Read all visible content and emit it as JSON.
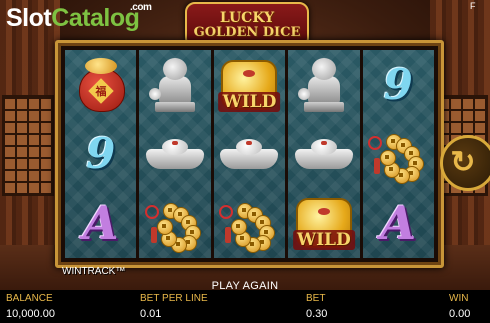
{
  "watermark": {
    "part1": "Slot",
    "part2": "Catalog",
    "suffix": ".com"
  },
  "game_title": {
    "line1": "LUCKY",
    "line2": "GOLDEN DICE"
  },
  "reels": [
    [
      "golden-pot",
      "nine",
      "letter-a"
    ],
    [
      "lion-statue",
      "silver-ingot",
      "coin-string"
    ],
    [
      "golden-dice-wild",
      "silver-ingot",
      "coin-string"
    ],
    [
      "lion-statue",
      "silver-ingot",
      "golden-dice-wild"
    ],
    [
      "nine",
      "coin-string",
      "letter-a"
    ]
  ],
  "symbol_text": {
    "nine": "9",
    "letter_a": "A",
    "wild": "WILD",
    "pot_sign": "福"
  },
  "wintrack": "WINTRACK™",
  "status_message": "PLAY AGAIN",
  "menu_hint": "F",
  "spin_icon": "refresh-arrow-icon",
  "bottom_bar": {
    "balance": {
      "label": "BALANCE",
      "value": "10,000.00"
    },
    "bet_per_line": {
      "label": "BET PER LINE",
      "value": "0.01"
    },
    "bet": {
      "label": "BET",
      "value": "0.30"
    },
    "win": {
      "label": "WIN",
      "value": "0.00"
    }
  },
  "colors": {
    "accent_gold": "#e8b84a",
    "reel_teal": "#2a5964",
    "bar_bg": "#000000"
  }
}
